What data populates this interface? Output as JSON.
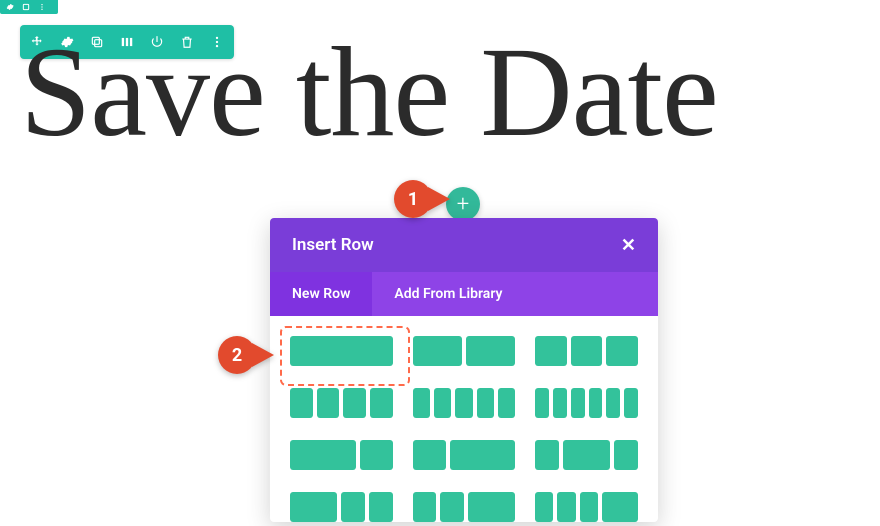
{
  "headline": "Save the Date",
  "toolbar_icons": [
    "move",
    "settings",
    "duplicate",
    "columns",
    "power",
    "delete",
    "more"
  ],
  "modal": {
    "title": "Insert Row",
    "close_glyph": "✕",
    "tabs": {
      "new_row": "New Row",
      "from_library": "Add From Library"
    },
    "layouts": [
      [
        1
      ],
      [
        1,
        1
      ],
      [
        1,
        1,
        1
      ],
      [
        1,
        1,
        1,
        1
      ],
      [
        1,
        1,
        1,
        1,
        1
      ],
      [
        1,
        1,
        1,
        1,
        1,
        1
      ],
      [
        2,
        1
      ],
      [
        1,
        2
      ],
      [
        1,
        2,
        1
      ],
      [
        2,
        1,
        1
      ],
      [
        1,
        1,
        2
      ],
      [
        1,
        1,
        1,
        2
      ]
    ]
  },
  "callouts": {
    "one": "1",
    "two": "2"
  },
  "add_glyph": "+"
}
